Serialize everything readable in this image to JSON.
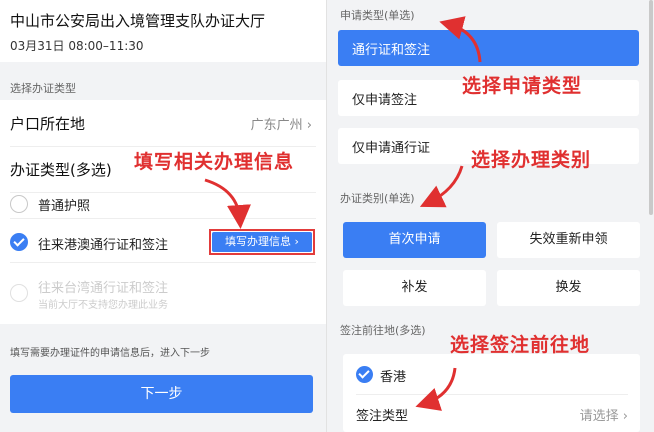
{
  "left": {
    "hall_name": "中山市公安局出入境管理支队办证大厅",
    "hall_time": "03月31日 08:00–11:30",
    "section_label": "选择办证类型",
    "residence": {
      "label": "户口所在地",
      "value": "广东广州 ›"
    },
    "cert_type_label": "办证类型(多选)",
    "options": [
      {
        "label": "普通护照",
        "checked": false
      },
      {
        "label": "往来港澳通行证和签注",
        "checked": true,
        "action": "填写办理信息 ›"
      },
      {
        "label": "往来台湾通行证和签注",
        "sub": "当前大厅不支持您办理此业务",
        "disabled": true
      }
    ],
    "hint": "填写需要办理证件的申请信息后，进入下一步",
    "next_button": "下一步"
  },
  "right": {
    "apply_type_label": "申请类型(单选)",
    "apply_types": [
      "通行证和签注",
      "仅申请签注",
      "仅申请通行证"
    ],
    "category_label": "办证类别(单选)",
    "categories": [
      "首次申请",
      "失效重新申领",
      "补发",
      "换发"
    ],
    "destination_label": "签注前往地(多选)",
    "destination": "香港",
    "visa_type_label": "签注类型",
    "visa_type_value": "请选择 ›"
  },
  "annotations": {
    "fill_info": "填写相关办理信息",
    "apply_type": "选择申请类型",
    "category": "选择办理类别",
    "destination": "选择签注前往地"
  },
  "colors": {
    "accent": "#3a7ef3",
    "annotation": "#e03030"
  }
}
